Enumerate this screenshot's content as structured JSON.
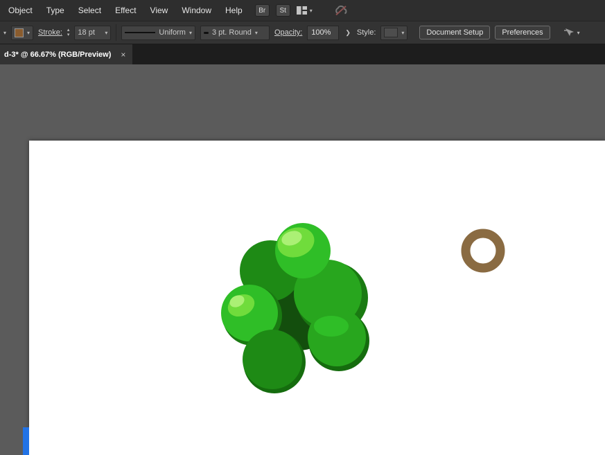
{
  "menu_bar": {
    "items": [
      "Object",
      "Type",
      "Select",
      "Effect",
      "View",
      "Window",
      "Help"
    ],
    "br_label": "Br",
    "st_label": "St"
  },
  "control_bar": {
    "fill_color": "#8a5c2e",
    "stroke_label": "Stroke:",
    "stroke_value": "18 pt",
    "profile_label": "Uniform",
    "brush_label": "3 pt. Round",
    "opacity_label": "Opacity:",
    "opacity_value": "100%",
    "style_label": "Style:",
    "document_setup_label": "Document Setup",
    "preferences_label": "Preferences"
  },
  "tab_bar": {
    "title": "d-3* @ 66.67% (RGB/Preview)",
    "close": "×"
  },
  "icons": {
    "dropdown": "▾",
    "up": "▴",
    "down": "▾",
    "chevron_right": "❯"
  },
  "canvas": {
    "background": "#5b5b5b",
    "artboard_color": "#ffffff",
    "artwork": {
      "ball_bright": "#2fbe27",
      "ball_mid": "#28a61e",
      "ball_dark": "#1e8a15",
      "ball_shadow": "#1a7a12",
      "deep_shadow": "#156c0e",
      "center_dark": "#134e0d",
      "highlight": "#70dc3c",
      "highlight_bright": "#abf075",
      "ring": "#8a6b42",
      "blue_strip": "#2273e6"
    }
  }
}
